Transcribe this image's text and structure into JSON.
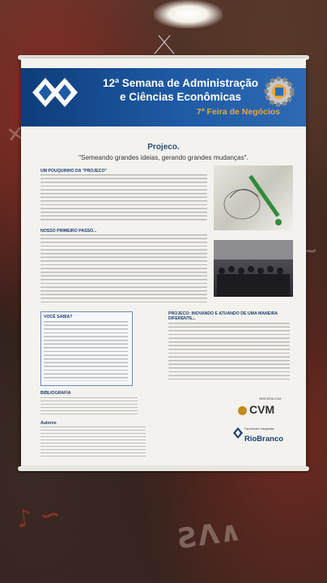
{
  "poster": {
    "header_title_line1": "12ª Semana de Administração",
    "header_title_line2": "e Ciências Econômicas",
    "header_subtitle": "7ª Feira de Negócios",
    "project_title": "Projeco.",
    "slogan": "\"Semeando grandes ideias, gerando grandes mudanças\".",
    "sections": {
      "about_heading": "UM POUQUINHO DA \"PROJECO\"",
      "first_step_heading": "NOSSO PRIMEIRO PASSO...",
      "did_you_know_heading": "VOCÊ SABIA?",
      "acting_heading": "PROJECO: INOVANDO E ATUANDO DE UMA MANEIRA DIFERENTE...",
      "bibliography_heading": "BIBLIOGRAFIA",
      "authors_heading": "Autores"
    },
    "partner_label": "PARCERIA COM",
    "partner_logo": "CVM",
    "institution_line": "Faculdades Integradas",
    "institution_logo": "RioBranco"
  },
  "colors": {
    "header_blue": "#1f5aa5",
    "subtitle_orange": "#e8a63a",
    "heading_blue": "#1c3f73"
  }
}
